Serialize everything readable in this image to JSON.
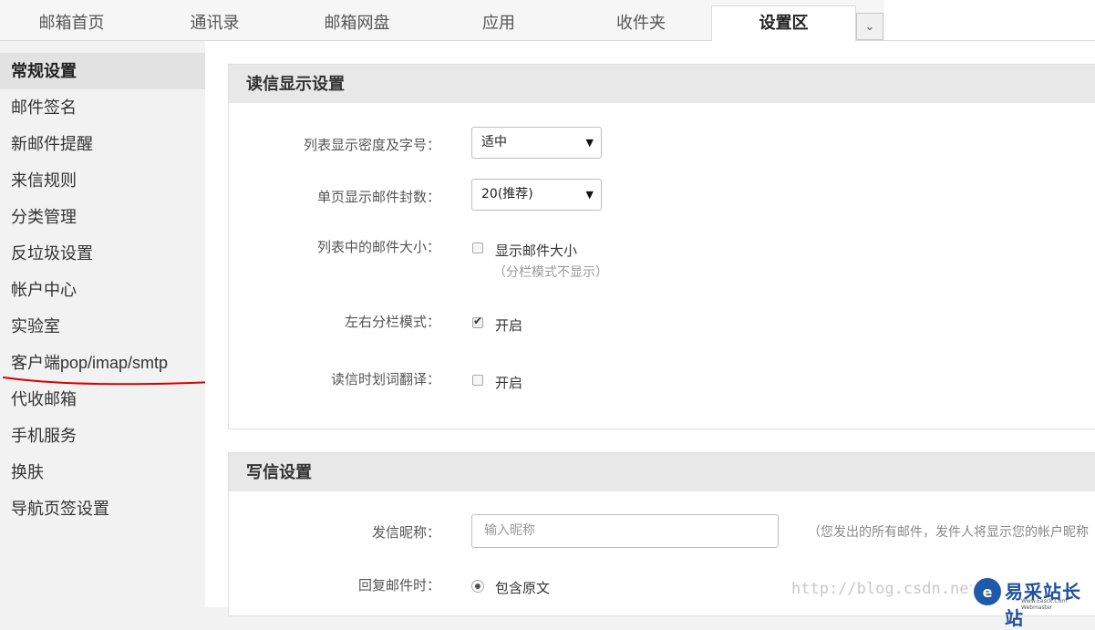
{
  "tabs": [
    "邮箱首页",
    "通讯录",
    "邮箱网盘",
    "应用",
    "收件夹",
    "设置区"
  ],
  "tab_more_icon": "chevron-down-icon",
  "sidebar": {
    "items": [
      "常规设置",
      "邮件签名",
      "新邮件提醒",
      "来信规则",
      "分类管理",
      "反垃圾设置",
      "帐户中心",
      "实验室",
      "客户端pop/imap/smtp",
      "代收邮箱",
      "手机服务",
      "换肤",
      "导航页签设置"
    ],
    "active_index": 0,
    "underline_color": "#d80000"
  },
  "reading": {
    "title": "读信显示设置",
    "density_label": "列表显示密度及字号：",
    "density_value": "适中",
    "perpage_label": "单页显示邮件封数：",
    "perpage_value": "20(推荐)",
    "size_label": "列表中的邮件大小：",
    "size_option": "显示邮件大小",
    "size_hint": "（分栏模式不显示）",
    "size_checked": false,
    "split_label": "左右分栏模式：",
    "split_option": "开启",
    "split_checked": true,
    "translate_label": "读信时划词翻译：",
    "translate_option": "开启",
    "translate_checked": false
  },
  "writing": {
    "title": "写信设置",
    "nickname_label": "发信昵称：",
    "nickname_placeholder": "输入昵称",
    "nickname_note": "（您发出的所有邮件，发件人将显示您的帐户昵称",
    "reply_label": "回复邮件时：",
    "reply_option": "包含原文",
    "reply_selected": true
  },
  "watermark": "http://blog.csdn.net",
  "logo": {
    "mark": "e",
    "name": "易采站长站",
    "sub": "Www.Easck.Com Webmaster"
  }
}
